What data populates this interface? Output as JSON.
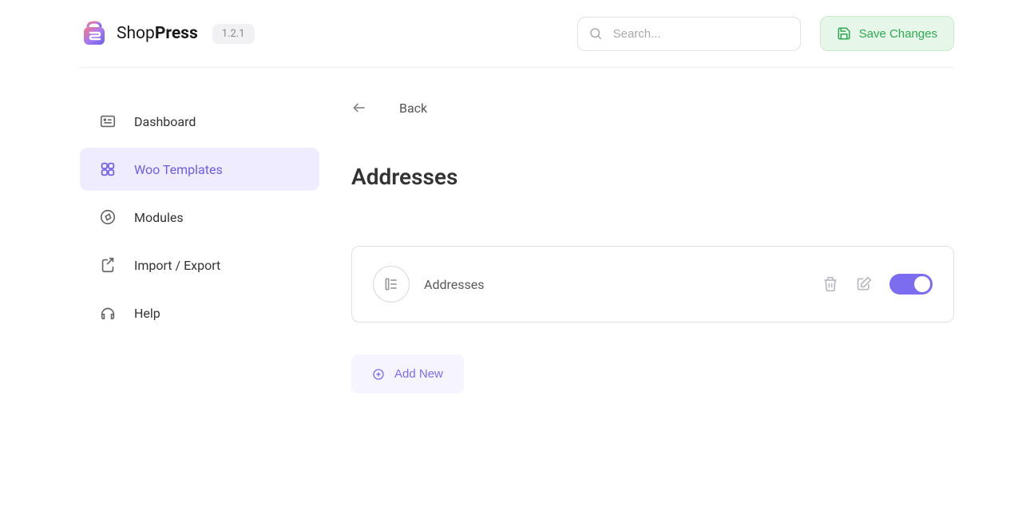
{
  "brand": {
    "name_light": "Shop",
    "name_bold": "Press"
  },
  "version": "1.2.1",
  "search": {
    "placeholder": "Search..."
  },
  "actions": {
    "save": "Save Changes"
  },
  "nav": {
    "items": [
      {
        "label": "Dashboard"
      },
      {
        "label": "Woo Templates"
      },
      {
        "label": "Modules"
      },
      {
        "label": "Import / Export"
      },
      {
        "label": "Help"
      }
    ]
  },
  "back": {
    "label": "Back"
  },
  "page": {
    "title": "Addresses"
  },
  "template": {
    "name": "Addresses",
    "enabled": true
  },
  "addNew": {
    "label": "Add New"
  },
  "colors": {
    "accent": "#7b6cf0",
    "success": "#2fa84f"
  }
}
